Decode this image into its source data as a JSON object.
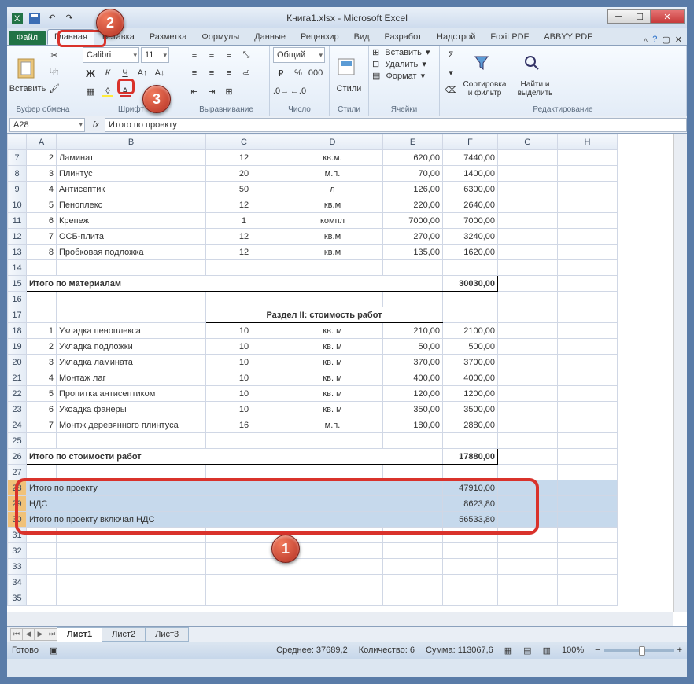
{
  "titlebar": {
    "title": "Книга1.xlsx - Microsoft Excel"
  },
  "tabs": {
    "file": "Файл",
    "items": [
      "Главная",
      "Вставка",
      "Разметка",
      "Формулы",
      "Данные",
      "Рецензир",
      "Вид",
      "Разработ",
      "Надстрой",
      "Foxit PDF",
      "ABBYY PDF"
    ],
    "active_index": 0
  },
  "ribbon": {
    "clipboard": {
      "paste": "Вставить",
      "label": "Буфер обмена"
    },
    "font": {
      "name": "Calibri",
      "size": "11",
      "label": "Шрифт",
      "grow": "A",
      "shrink": "A"
    },
    "alignment": {
      "label": "Выравнивание"
    },
    "number": {
      "format": "Общий",
      "label": "Число"
    },
    "styles": {
      "styles": "Стили",
      "label": "Стили"
    },
    "cells": {
      "insert": "Вставить",
      "delete": "Удалить",
      "format": "Формат",
      "label": "Ячейки"
    },
    "editing": {
      "sort": "Сортировка и фильтр",
      "find": "Найти и выделить",
      "label": "Редактирование"
    }
  },
  "formulabar": {
    "namebox": "A28",
    "fx": "fx",
    "value": "Итого по проекту"
  },
  "columns": [
    "",
    "A",
    "B",
    "C",
    "D",
    "E",
    "F",
    "G",
    "H"
  ],
  "rows": [
    {
      "n": 7,
      "a": "2",
      "b": "Ламинат",
      "c": "12",
      "d": "кв.м.",
      "e": "620,00",
      "f": "7440,00",
      "border": true
    },
    {
      "n": 8,
      "a": "3",
      "b": "Плинтус",
      "c": "20",
      "d": "м.п.",
      "e": "70,00",
      "f": "1400,00",
      "border": true
    },
    {
      "n": 9,
      "a": "4",
      "b": "Антисептик",
      "c": "50",
      "d": "л",
      "e": "126,00",
      "f": "6300,00",
      "border": true
    },
    {
      "n": 10,
      "a": "5",
      "b": "Пеноплекс",
      "c": "12",
      "d": "кв.м",
      "e": "220,00",
      "f": "2640,00",
      "border": true
    },
    {
      "n": 11,
      "a": "6",
      "b": "Крепеж",
      "c": "1",
      "d": "компл",
      "e": "7000,00",
      "f": "7000,00",
      "border": true
    },
    {
      "n": 12,
      "a": "7",
      "b": "ОСБ-плита",
      "c": "12",
      "d": "кв.м",
      "e": "270,00",
      "f": "3240,00",
      "border": true
    },
    {
      "n": 13,
      "a": "8",
      "b": "Пробковая подложка",
      "c": "12",
      "d": "кв.м",
      "e": "135,00",
      "f": "1620,00",
      "border": true
    },
    {
      "n": 14,
      "a": "",
      "b": "",
      "c": "",
      "d": "",
      "e": "",
      "f": "",
      "thin": true
    },
    {
      "n": 15,
      "a": "Итого по материалам",
      "b": "",
      "c": "",
      "d": "",
      "e": "",
      "f": "30030,00",
      "thin": true,
      "bold": true,
      "merge": true
    },
    {
      "n": 16,
      "a": "",
      "b": "",
      "c": "",
      "d": "",
      "e": "",
      "f": "",
      "thin": true
    },
    {
      "n": 17,
      "a": "",
      "b": "",
      "c": "Раздел II: стоимость работ",
      "d": "",
      "e": "",
      "f": "",
      "thin": true,
      "section": true
    },
    {
      "n": 18,
      "a": "1",
      "b": "Укладка пеноплекса",
      "c": "10",
      "d": "кв. м",
      "e": "210,00",
      "f": "2100,00",
      "border": true
    },
    {
      "n": 19,
      "a": "2",
      "b": "Укладка подложки",
      "c": "10",
      "d": "кв. м",
      "e": "50,00",
      "f": "500,00",
      "border": true
    },
    {
      "n": 20,
      "a": "3",
      "b": "Укладка  ламината",
      "c": "10",
      "d": "кв. м",
      "e": "370,00",
      "f": "3700,00",
      "border": true
    },
    {
      "n": 21,
      "a": "4",
      "b": "Монтаж лаг",
      "c": "10",
      "d": "кв. м",
      "e": "400,00",
      "f": "4000,00",
      "border": true
    },
    {
      "n": 22,
      "a": "5",
      "b": "Пропитка антисептиком",
      "c": "10",
      "d": "кв. м",
      "e": "120,00",
      "f": "1200,00",
      "border": true
    },
    {
      "n": 23,
      "a": "6",
      "b": "Укоадка фанеры",
      "c": "10",
      "d": "кв. м",
      "e": "350,00",
      "f": "3500,00",
      "border": true
    },
    {
      "n": 24,
      "a": "7",
      "b": "Монтж деревянного плинтуса",
      "c": "16",
      "d": "м.п.",
      "e": "180,00",
      "f": "2880,00",
      "border": true
    },
    {
      "n": 25,
      "a": "",
      "b": "",
      "c": "",
      "d": "",
      "e": "",
      "f": "",
      "thin": true
    },
    {
      "n": 26,
      "a": "Итого по стоимости работ",
      "b": "",
      "c": "",
      "d": "",
      "e": "",
      "f": "17880,00",
      "thin": true,
      "bold": true,
      "merge": true
    },
    {
      "n": 27,
      "a": "",
      "b": "",
      "c": "",
      "d": "",
      "e": "",
      "f": ""
    },
    {
      "n": 28,
      "a": "Итого по проекту",
      "b": "",
      "c": "",
      "d": "",
      "e": "",
      "f": "47910,00",
      "sel": true,
      "merge": true
    },
    {
      "n": 29,
      "a": "НДС",
      "b": "",
      "c": "",
      "d": "",
      "e": "",
      "f": "8623,80",
      "sel": true,
      "merge": true
    },
    {
      "n": 30,
      "a": "Итого по проекту включая НДС",
      "b": "",
      "c": "",
      "d": "",
      "e": "",
      "f": "56533,80",
      "sel": true,
      "merge": true
    },
    {
      "n": 31,
      "a": "",
      "b": "",
      "c": "",
      "d": "",
      "e": "",
      "f": ""
    },
    {
      "n": 32,
      "a": "",
      "b": "",
      "c": "",
      "d": "",
      "e": "",
      "f": ""
    },
    {
      "n": 33,
      "a": "",
      "b": "",
      "c": "",
      "d": "",
      "e": "",
      "f": ""
    },
    {
      "n": 34,
      "a": "",
      "b": "",
      "c": "",
      "d": "",
      "e": "",
      "f": ""
    },
    {
      "n": 35,
      "a": "",
      "b": "",
      "c": "",
      "d": "",
      "e": "",
      "f": ""
    }
  ],
  "sheets": {
    "items": [
      "Лист1",
      "Лист2",
      "Лист3"
    ],
    "active_index": 0
  },
  "statusbar": {
    "ready": "Готово",
    "avg": "Среднее: 37689,2",
    "count": "Количество: 6",
    "sum": "Сумма: 113067,6",
    "zoom": "100%"
  },
  "callouts": {
    "c1": "1",
    "c2": "2",
    "c3": "3"
  }
}
